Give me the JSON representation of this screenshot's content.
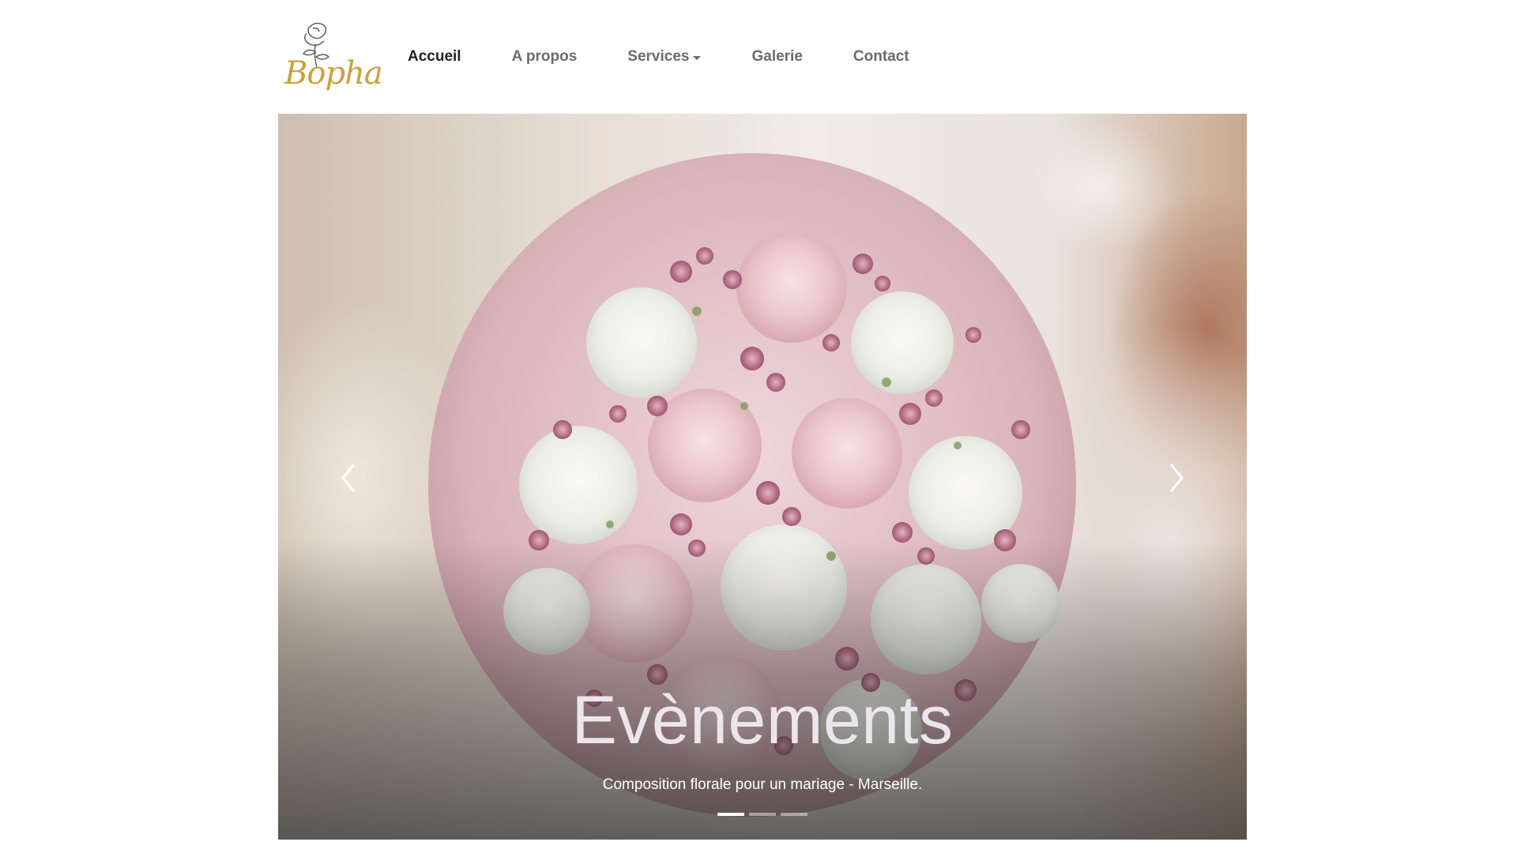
{
  "brand": {
    "name": "Bopha",
    "logo_text": "Bopha",
    "logo_icon": "rose-flower-icon",
    "gold_color": "#c9a23a"
  },
  "nav": {
    "items": [
      {
        "label": "Accueil",
        "active": true
      },
      {
        "label": "A propos",
        "active": false
      },
      {
        "label": "Services",
        "active": false,
        "dropdown": true
      },
      {
        "label": "Galerie",
        "active": false
      },
      {
        "label": "Contact",
        "active": false
      }
    ]
  },
  "carousel": {
    "slides": [
      {
        "title": "Evènements",
        "caption": "Composition florale pour un mariage - Marseille."
      }
    ],
    "active_index": 0,
    "indicator_count": 3,
    "prev_icon": "chevron-left-icon",
    "next_icon": "chevron-right-icon"
  }
}
